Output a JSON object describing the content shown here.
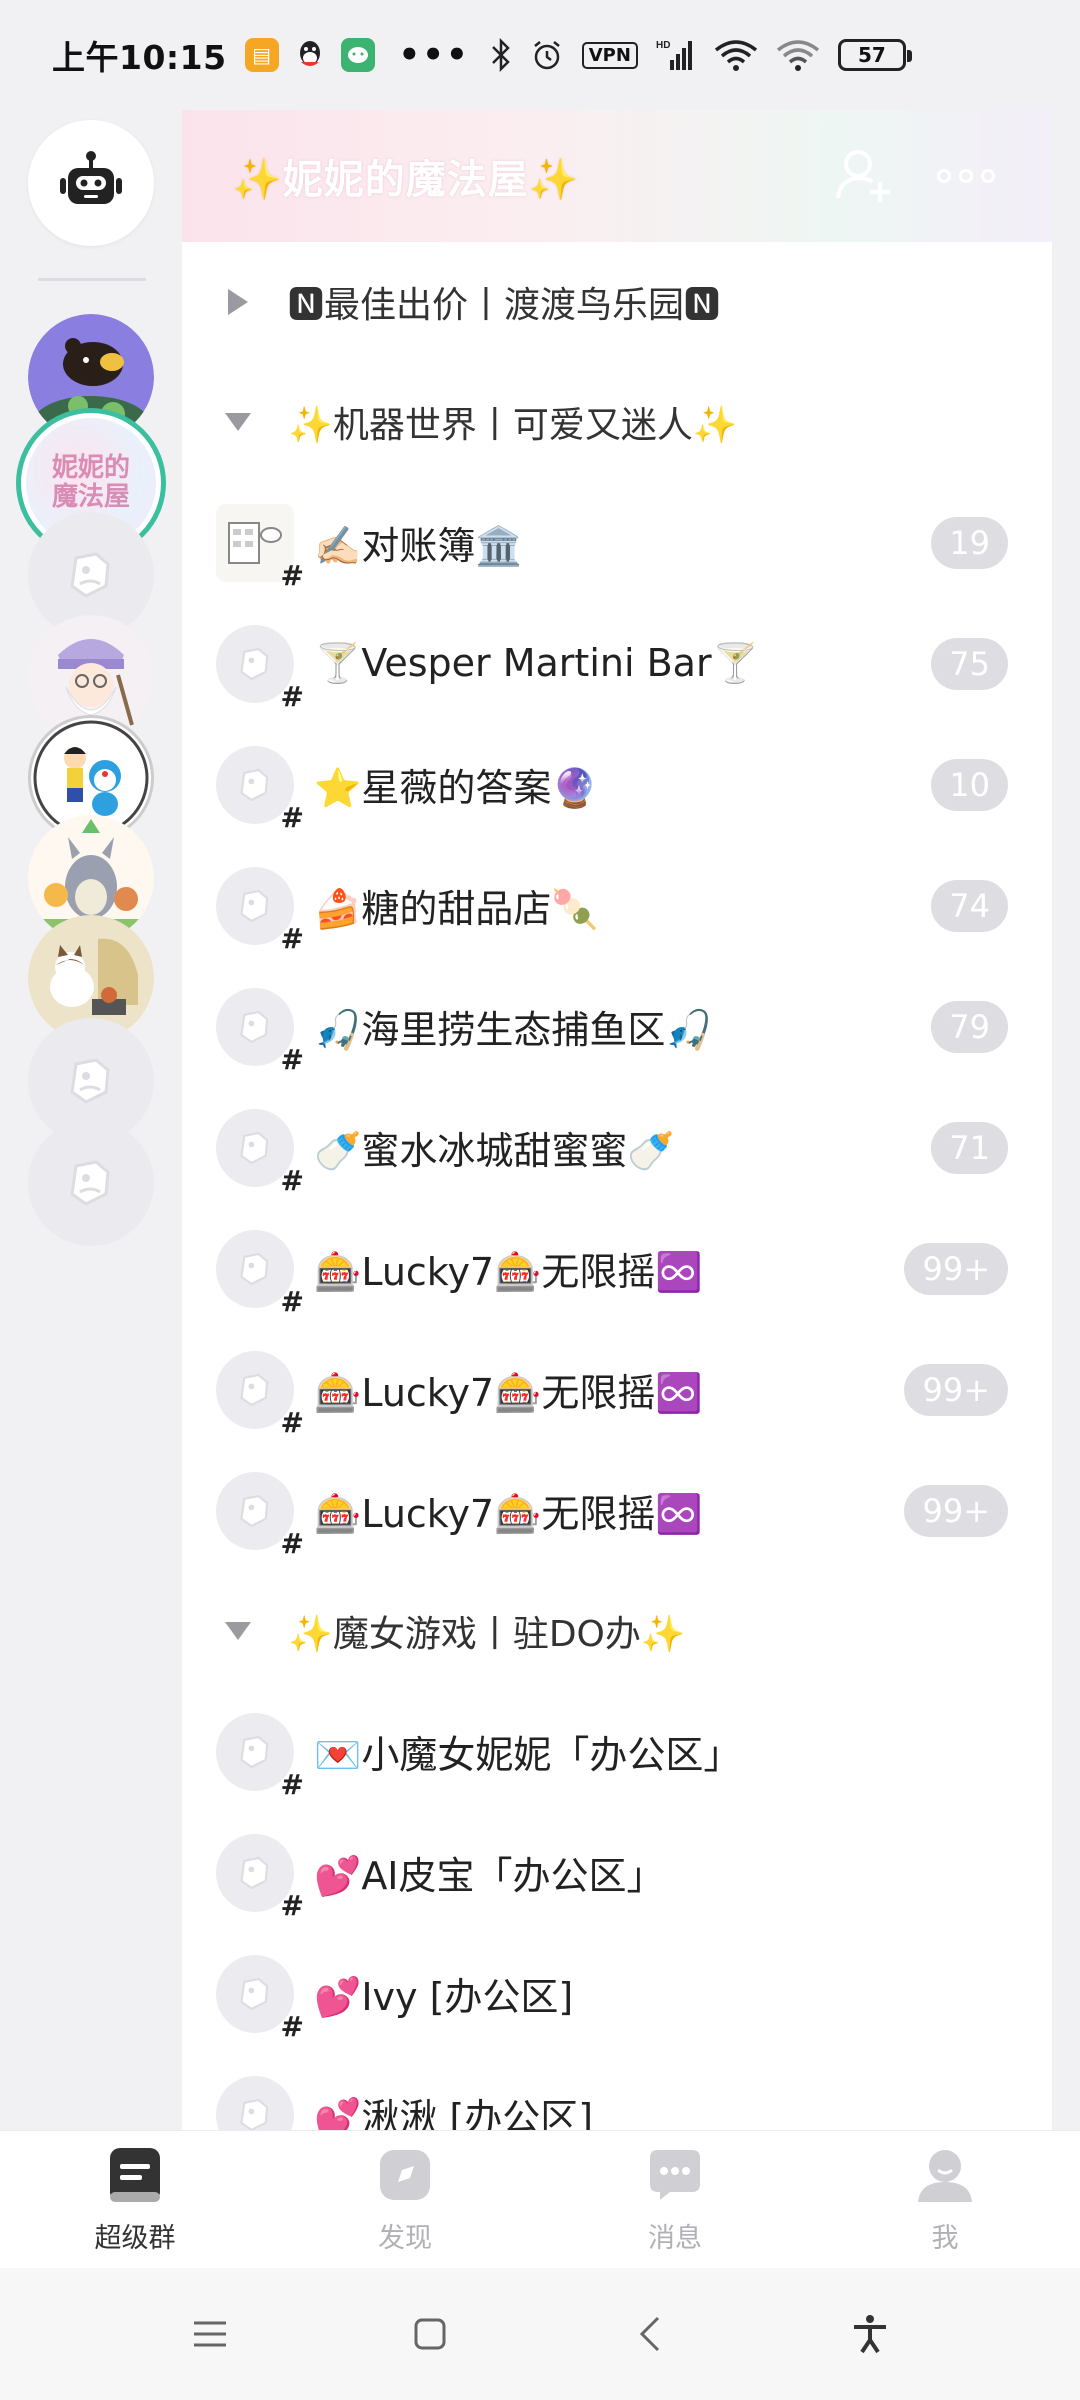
{
  "status_bar": {
    "time": "上午10:15",
    "vpn": "VPN",
    "battery": "57",
    "icons": [
      "notes-app-icon",
      "qq-icon",
      "wechat-icon",
      "bluetooth-icon",
      "alarm-icon",
      "vpn-icon",
      "signal-icon",
      "wifi-icon",
      "wifi-icon",
      "battery-icon"
    ]
  },
  "rail": {
    "items": [
      {
        "name": "bot-button"
      },
      {
        "name": "server-bear"
      },
      {
        "name": "server-magic-house",
        "selected": true
      },
      {
        "name": "server-placeholder"
      },
      {
        "name": "server-wizard"
      },
      {
        "name": "server-doraemon"
      },
      {
        "name": "server-totoro"
      },
      {
        "name": "server-cat"
      },
      {
        "name": "server-placeholder"
      },
      {
        "name": "server-placeholder"
      }
    ]
  },
  "header": {
    "title": "✨妮妮的魔法屋✨"
  },
  "groups": [
    {
      "label": "🅽最佳出价丨渡渡鸟乐园🅽",
      "expanded": false,
      "channels": []
    },
    {
      "label": "✨机器世界丨可爱又迷人✨",
      "expanded": true,
      "channels": [
        {
          "name": "✍🏻对账簿🏛️",
          "badge": "19",
          "icon": "ledger-image"
        },
        {
          "name": "🍸Vesper Martini Bar🍸",
          "badge": "75",
          "icon": "default"
        },
        {
          "name": "⭐星薇的答案🔮",
          "badge": "10",
          "icon": "default"
        },
        {
          "name": "🍰糖的甜品店🍡",
          "badge": "74",
          "icon": "default"
        },
        {
          "name": "🎣海里捞生态捕鱼区🎣",
          "badge": "79",
          "icon": "default"
        },
        {
          "name": "🍼蜜水冰城甜蜜蜜🍼",
          "badge": "71",
          "icon": "default"
        },
        {
          "name": "🎰Lucky7🎰无限摇♾️",
          "badge": "99+",
          "icon": "default"
        },
        {
          "name": "🎰Lucky7🎰无限摇♾️",
          "badge": "99+",
          "icon": "default"
        },
        {
          "name": "🎰Lucky7🎰无限摇♾️",
          "badge": "99+",
          "icon": "default"
        }
      ]
    },
    {
      "label": "✨魔女游戏丨驻DO办✨",
      "expanded": true,
      "channels": [
        {
          "name": "💌小魔女妮妮「办公区」",
          "badge": "",
          "icon": "default"
        },
        {
          "name": "💕AI皮宝「办公区」",
          "badge": "",
          "icon": "default"
        },
        {
          "name": "💕Ivy [办公区]",
          "badge": "",
          "icon": "default"
        },
        {
          "name": "💕湫湫 [办公区]",
          "badge": "",
          "icon": "default"
        }
      ]
    }
  ],
  "tabbar": {
    "tabs": [
      {
        "label": "超级群",
        "icon": "supergroup-icon",
        "active": true
      },
      {
        "label": "发现",
        "icon": "discover-icon",
        "active": false
      },
      {
        "label": "消息",
        "icon": "message-icon",
        "active": false
      },
      {
        "label": "我",
        "icon": "profile-icon",
        "active": false
      }
    ]
  },
  "colors": {
    "accent_ring": "#3bbf9e",
    "badge_bg": "#dedee2",
    "page_bg": "#f1f1f4"
  }
}
